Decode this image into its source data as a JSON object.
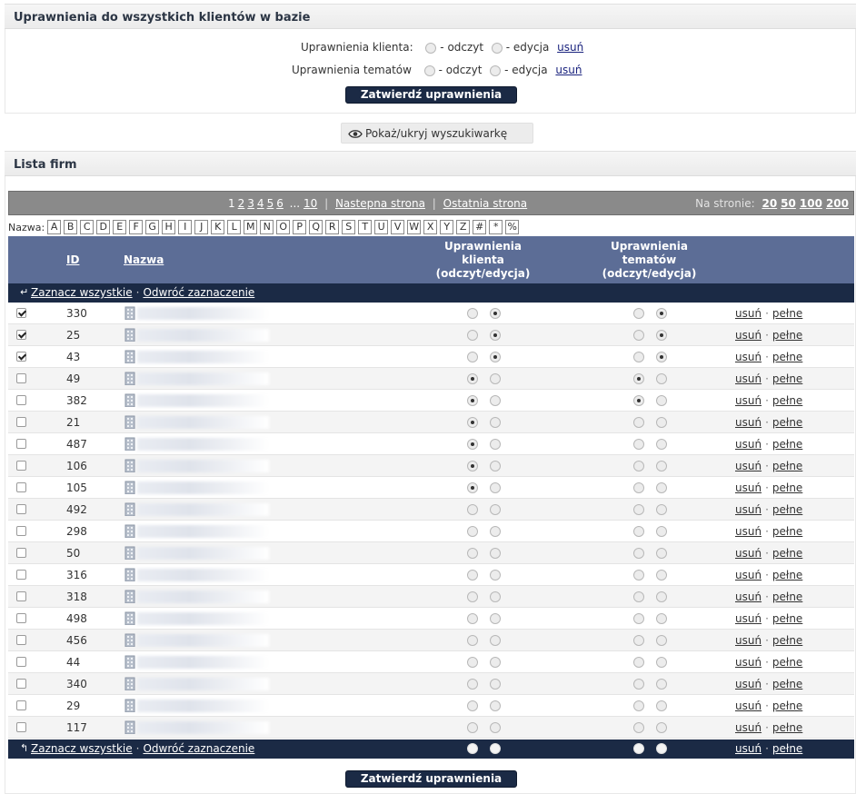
{
  "top_panel": {
    "title": "Uprawnienia do wszystkich klientów w bazie",
    "client_perm_label": "Uprawnienia klienta:",
    "topic_perm_label": "Uprawnienia tematów",
    "read_label": "- odczyt",
    "edit_label": "- edycja",
    "remove_label": "usuń",
    "confirm_button": "Zatwierdź uprawnienia"
  },
  "search_toggle": {
    "label": "Pokaż/ukryj wyszukiwarkę",
    "icon": "eye-icon"
  },
  "list_panel": {
    "title": "Lista firm"
  },
  "pager": {
    "pages": [
      "1",
      "2",
      "3",
      "4",
      "5",
      "6"
    ],
    "current_page": "1",
    "ellipsis": "...",
    "last_page": "10",
    "next_label": "Nastepna strona",
    "last_label": "Ostatnia strona",
    "per_page_label": "Na stronie:",
    "per_page_options": [
      "20",
      "50",
      "100",
      "200"
    ]
  },
  "alphabet": {
    "label": "Nazwa:",
    "letters": [
      "A",
      "B",
      "C",
      "D",
      "E",
      "F",
      "G",
      "H",
      "I",
      "J",
      "K",
      "L",
      "M",
      "N",
      "O",
      "P",
      "Q",
      "R",
      "S",
      "T",
      "U",
      "V",
      "W",
      "X",
      "Y",
      "Z",
      "#",
      "*",
      "%"
    ]
  },
  "table": {
    "col_id": "ID",
    "col_name": "Nazwa",
    "col_client_perm": [
      "Uprawnienia",
      "klienta",
      "(odczyt/edycja)"
    ],
    "col_topic_perm": [
      "Uprawnienia",
      "tematów",
      "(odczyt/edycja)"
    ],
    "select_all": "Zaznacz wszystkie",
    "invert_selection": "Odwróć zaznaczenie",
    "row_remove": "usuń",
    "row_full": "pełne",
    "rows": [
      {
        "id": "330",
        "checked": true,
        "client": "edit",
        "topic": "edit"
      },
      {
        "id": "25",
        "checked": true,
        "client": "edit",
        "topic": "edit"
      },
      {
        "id": "43",
        "checked": true,
        "client": "edit",
        "topic": "edit"
      },
      {
        "id": "49",
        "checked": false,
        "client": "read",
        "topic": "read"
      },
      {
        "id": "382",
        "checked": false,
        "client": "read",
        "topic": "read"
      },
      {
        "id": "21",
        "checked": false,
        "client": "read",
        "topic": "none"
      },
      {
        "id": "487",
        "checked": false,
        "client": "read",
        "topic": "none"
      },
      {
        "id": "106",
        "checked": false,
        "client": "read",
        "topic": "none"
      },
      {
        "id": "105",
        "checked": false,
        "client": "read",
        "topic": "none"
      },
      {
        "id": "492",
        "checked": false,
        "client": "none",
        "topic": "none"
      },
      {
        "id": "298",
        "checked": false,
        "client": "none",
        "topic": "none"
      },
      {
        "id": "50",
        "checked": false,
        "client": "none",
        "topic": "none"
      },
      {
        "id": "316",
        "checked": false,
        "client": "none",
        "topic": "none"
      },
      {
        "id": "318",
        "checked": false,
        "client": "none",
        "topic": "none"
      },
      {
        "id": "498",
        "checked": false,
        "client": "none",
        "topic": "none"
      },
      {
        "id": "456",
        "checked": false,
        "client": "none",
        "topic": "none"
      },
      {
        "id": "44",
        "checked": false,
        "client": "none",
        "topic": "none"
      },
      {
        "id": "340",
        "checked": false,
        "client": "none",
        "topic": "none"
      },
      {
        "id": "29",
        "checked": false,
        "client": "none",
        "topic": "none"
      },
      {
        "id": "117",
        "checked": false,
        "client": "none",
        "topic": "none"
      }
    ]
  },
  "bottom_confirm_button": "Zatwierdź uprawnienia",
  "colors": {
    "header_blue": "#5c6d96",
    "dark_navy": "#1b2a45",
    "pager_gray": "#8a8a8a"
  }
}
